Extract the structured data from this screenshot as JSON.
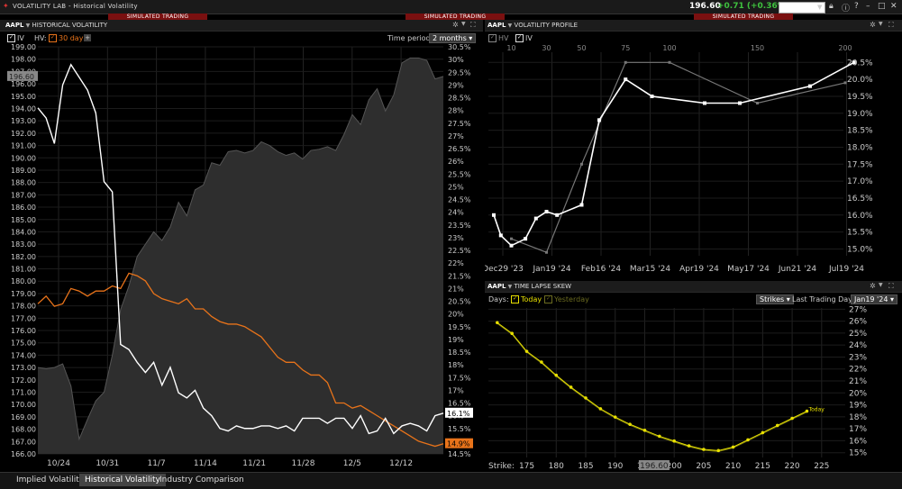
{
  "app": {
    "title": "VOLATILITY LAB - Historical Volatility"
  },
  "quote": {
    "price": "196.60",
    "change": "+0.71 (+0.36%)"
  },
  "sim_banner": "SIMULATED TRADING",
  "hv_panel": {
    "ticker": "AAPL",
    "title": "HISTORICAL VOLATILITY",
    "iv_label": "IV",
    "hv_label": "HV:",
    "hv_period": "30 day",
    "time_period_label": "Time period:",
    "time_period_value": "2 months",
    "price_marker": "196.60",
    "iv_marker": "16.1%",
    "hv_marker": "14.9%"
  },
  "profile_panel": {
    "ticker": "AAPL",
    "title": "VOLATILITY PROFILE",
    "hv_label": "HV",
    "iv_label": "IV"
  },
  "skew_panel": {
    "ticker": "AAPL",
    "title": "TIME LAPSE SKEW",
    "days_label": "Days:",
    "today_label": "Today",
    "yesterday_label": "Yesterday",
    "strikes_button": "Strikes",
    "last_trading_label": "Last Trading Day:",
    "last_trading_value": "Jan19 '24",
    "strike_label": "Strike:",
    "price_marker": "196.60",
    "series_label": "Today"
  },
  "bottom_tabs": [
    "Implied Volatility",
    "Historical Volatility",
    "Industry Comparison"
  ],
  "colors": {
    "iv": "#ffffff",
    "hv": "#e8731a",
    "skew": "#e8e000",
    "area": "#2e2e2e",
    "sim": "#7a1010"
  },
  "chart_data": [
    {
      "type": "line",
      "name": "historical-volatility",
      "x_ticks": [
        "10/24",
        "10/31",
        "11/7",
        "11/14",
        "11/21",
        "11/28",
        "12/5",
        "12/12"
      ],
      "y_left_ticks": [
        "199.00",
        "198.00",
        "197.00",
        "196.00",
        "195.00",
        "194.00",
        "193.00",
        "192.00",
        "191.00",
        "190.00",
        "189.00",
        "188.00",
        "187.00",
        "186.00",
        "185.00",
        "184.00",
        "183.00",
        "182.00",
        "181.00",
        "180.00",
        "179.00",
        "178.00",
        "177.00",
        "176.00",
        "175.00",
        "174.00",
        "173.00",
        "172.00",
        "171.00",
        "170.00",
        "169.00",
        "168.00",
        "167.00",
        "166.00"
      ],
      "y_right_ticks": [
        "30.5%",
        "30%",
        "29.5%",
        "29%",
        "28.5%",
        "28%",
        "27.5%",
        "27%",
        "26.5%",
        "26%",
        "25.5%",
        "25%",
        "24.5%",
        "24%",
        "23.5%",
        "23%",
        "22.5%",
        "22%",
        "21.5%",
        "21%",
        "20.5%",
        "20%",
        "19.5%",
        "19%",
        "18.5%",
        "18%",
        "17.5%",
        "17%",
        "16.5%",
        "16%",
        "15.5%",
        "15%",
        "14.5%"
      ],
      "ylim_left": [
        166,
        199
      ],
      "ylim_right": [
        14.5,
        30.5
      ],
      "x_days": [
        0,
        2,
        4,
        6,
        8,
        10,
        12,
        14,
        16,
        18,
        20,
        22,
        24,
        26,
        28,
        30,
        32,
        34,
        36,
        38,
        40,
        42,
        44,
        46,
        48,
        50,
        52,
        54,
        56,
        58,
        60,
        62,
        64,
        66,
        68,
        70,
        72,
        74,
        76,
        78,
        80,
        82,
        84,
        86,
        88,
        90,
        92,
        94,
        96,
        98,
        100,
        102,
        104,
        106,
        108
      ],
      "series": [
        {
          "name": "Price",
          "axis": "left",
          "values": [
            173,
            172.9,
            173,
            173.3,
            171.5,
            167.2,
            168.8,
            170.3,
            171,
            174,
            177.7,
            179.6,
            182,
            183,
            184,
            183.3,
            184.4,
            186.4,
            185.3,
            187.4,
            187.8,
            189.6,
            189.4,
            190.5,
            190.6,
            190.4,
            190.6,
            191.3,
            191,
            190.5,
            190.2,
            190.4,
            189.9,
            190.6,
            190.7,
            190.9,
            190.6,
            191.9,
            193.5,
            192.7,
            194.7,
            195.6,
            193.8,
            195.1,
            197.7,
            198.1,
            198.1,
            197.9,
            196.4,
            196.6
          ]
        },
        {
          "name": "IV",
          "axis": "right",
          "values": [
            28.1,
            27.7,
            26.7,
            29,
            29.8,
            29.3,
            28.8,
            27.9,
            25.2,
            24.8,
            18.8,
            18.6,
            18.1,
            17.7,
            18.1,
            17.2,
            17.9,
            16.9,
            16.7,
            17,
            16.3,
            16,
            15.5,
            15.4,
            15.6,
            15.5,
            15.5,
            15.6,
            15.6,
            15.5,
            15.6,
            15.4,
            15.9,
            15.9,
            15.9,
            15.7,
            15.9,
            15.9,
            15.5,
            16,
            15.3,
            15.4,
            15.9,
            15.3,
            15.6,
            15.7,
            15.6,
            15.4,
            16,
            16.1
          ]
        },
        {
          "name": "HV",
          "axis": "right",
          "values": [
            20.4,
            20.7,
            20.3,
            20.4,
            21,
            20.9,
            20.7,
            20.9,
            20.9,
            21.1,
            21,
            21.6,
            21.5,
            21.3,
            20.8,
            20.6,
            20.5,
            20.4,
            20.6,
            20.2,
            20.2,
            19.9,
            19.7,
            19.6,
            19.6,
            19.5,
            19.3,
            19.1,
            18.7,
            18.3,
            18.1,
            18.1,
            17.8,
            17.6,
            17.6,
            17.3,
            16.5,
            16.5,
            16.3,
            16.4,
            16.2,
            16,
            15.8,
            15.6,
            15.4,
            15.2,
            15,
            14.9,
            14.8,
            14.9
          ]
        }
      ]
    },
    {
      "type": "line",
      "name": "volatility-profile",
      "x_ticks": [
        "Dec29 '23",
        "Jan19 '24",
        "Feb16 '24",
        "Mar15 '24",
        "Apr19 '24",
        "May17 '24",
        "Jun21 '24",
        "Jul19 '24"
      ],
      "dte_ticks": [
        "10",
        "30",
        "50",
        "75",
        "100",
        "150",
        "200"
      ],
      "y_ticks": [
        "20.5%",
        "20.0%",
        "19.5%",
        "19.0%",
        "18.5%",
        "18.0%",
        "17.5%",
        "17.0%",
        "16.5%",
        "16.0%",
        "15.5%",
        "15.0%"
      ],
      "ylim": [
        14.8,
        20.8
      ],
      "series": [
        {
          "name": "HV",
          "dte": [
            10,
            30,
            50,
            75,
            100,
            150,
            200
          ],
          "values": [
            15.3,
            14.9,
            17.5,
            20.5,
            20.5,
            19.3,
            19.9
          ]
        },
        {
          "name": "IV",
          "dte": [
            0,
            4,
            10,
            18,
            24,
            30,
            36,
            50,
            60,
            75,
            90,
            120,
            140,
            180,
            205
          ],
          "values": [
            16.0,
            15.4,
            15.1,
            15.3,
            15.9,
            16.1,
            16.0,
            16.3,
            18.8,
            20.0,
            19.5,
            19.3,
            19.3,
            19.8,
            20.5
          ]
        }
      ]
    },
    {
      "type": "line",
      "name": "time-lapse-skew",
      "x_ticks": [
        "175",
        "180",
        "185",
        "190",
        "195",
        "200",
        "205",
        "210",
        "215",
        "220",
        "225"
      ],
      "y_ticks": [
        "27%",
        "26%",
        "25%",
        "24%",
        "23%",
        "22%",
        "21%",
        "20%",
        "19%",
        "18%",
        "17%",
        "16%",
        "15%"
      ],
      "xlim": [
        168.5,
        229
      ],
      "ylim": [
        14.6,
        27.1
      ],
      "series": [
        {
          "name": "Today",
          "strikes": [
            170,
            172.5,
            175,
            177.5,
            180,
            182.5,
            185,
            187.5,
            190,
            192.5,
            195,
            197.5,
            200,
            202.5,
            205,
            207.5,
            210,
            212.5,
            215,
            217.5,
            220,
            222.5
          ],
          "values": [
            25.8,
            24.9,
            23.4,
            22.5,
            21.4,
            20.4,
            19.5,
            18.6,
            17.9,
            17.3,
            16.8,
            16.3,
            15.9,
            15.5,
            15.2,
            15.1,
            15.4,
            16.0,
            16.6,
            17.2,
            17.8,
            18.4
          ]
        }
      ]
    }
  ]
}
